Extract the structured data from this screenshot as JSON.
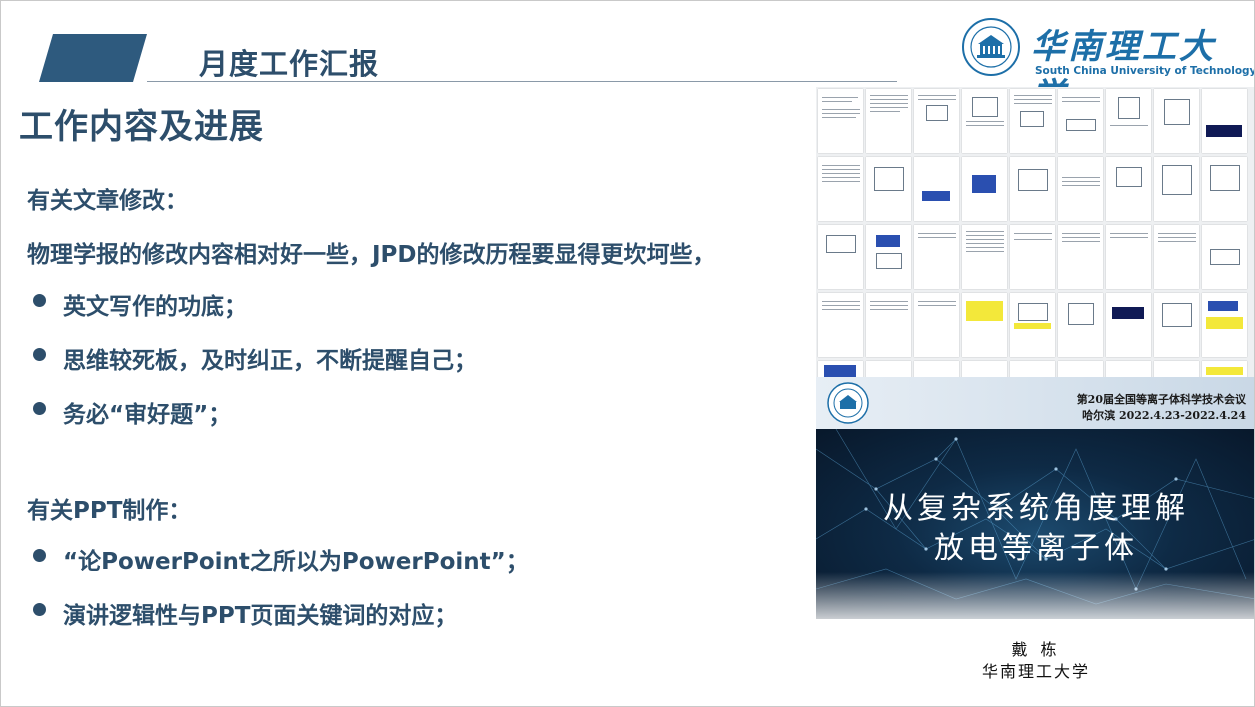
{
  "header": {
    "title": "月度工作汇报",
    "accent_color": "#2e5a7e"
  },
  "logo": {
    "cn": "华南理工大学",
    "en": "South China University of Technology",
    "color": "#1d6fa8"
  },
  "section_title": "工作内容及进展",
  "article": {
    "heading": "有关文章修改：",
    "intro": "物理学报的修改内容相对好一些，JPD的修改历程要显得更坎坷些，",
    "bullets": [
      "英文写作的功底；",
      "思维较死板，及时纠正，不断提醒自己；",
      "务必“审好题”；"
    ]
  },
  "ppt": {
    "heading": "有关PPT制作：",
    "bullets": [
      "“论PowerPoint之所以为PowerPoint”；",
      "演讲逻辑性与PPT页面关键词的对应；"
    ]
  },
  "conference_slide": {
    "line1": "第20届全国等离子体科学技术会议",
    "line2": "哈尔滨 2022.4.23-2022.4.24",
    "title_line1": "从复杂系统角度理解",
    "title_line2": "放电等离子体",
    "author": "戴 栋",
    "institution": "华南理工大学"
  }
}
